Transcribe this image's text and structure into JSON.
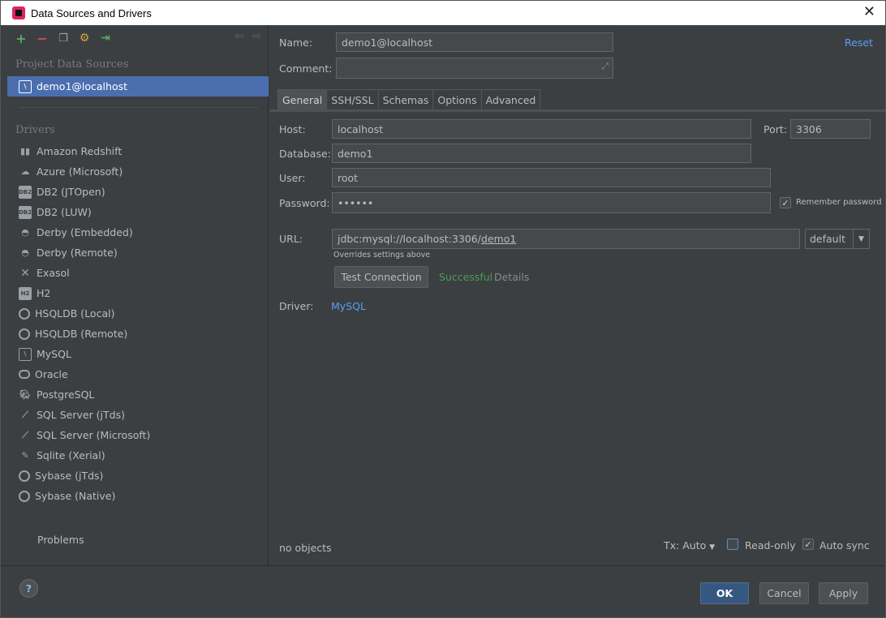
{
  "window": {
    "title": "Data Sources and Drivers",
    "close_glyph": "✕"
  },
  "left": {
    "nav_back": "⇦",
    "nav_forward": "⇨",
    "project_heading": "Project Data Sources",
    "selected_source": "demo1@localhost",
    "drivers_heading": "Drivers",
    "drivers": [
      {
        "label": "Amazon Redshift",
        "icon": "redshift-icon"
      },
      {
        "label": "Azure (Microsoft)",
        "icon": "azure-icon"
      },
      {
        "label": "DB2 (JTOpen)",
        "icon": "db2-icon"
      },
      {
        "label": "DB2 (LUW)",
        "icon": "db2-icon"
      },
      {
        "label": "Derby (Embedded)",
        "icon": "derby-icon"
      },
      {
        "label": "Derby (Remote)",
        "icon": "derby-icon"
      },
      {
        "label": "Exasol",
        "icon": "exasol-icon"
      },
      {
        "label": "H2",
        "icon": "h2-icon"
      },
      {
        "label": "HSQLDB (Local)",
        "icon": "hsqldb-icon"
      },
      {
        "label": "HSQLDB (Remote)",
        "icon": "hsqldb-icon"
      },
      {
        "label": "MySQL",
        "icon": "mysql-icon"
      },
      {
        "label": "Oracle",
        "icon": "oracle-icon"
      },
      {
        "label": "PostgreSQL",
        "icon": "postgresql-icon"
      },
      {
        "label": "SQL Server (jTds)",
        "icon": "sqlserver-icon"
      },
      {
        "label": "SQL Server (Microsoft)",
        "icon": "sqlserver-icon"
      },
      {
        "label": "Sqlite (Xerial)",
        "icon": "sqlite-icon"
      },
      {
        "label": "Sybase (jTds)",
        "icon": "sybase-icon"
      },
      {
        "label": "Sybase (Native)",
        "icon": "sybase-icon"
      }
    ],
    "problems_label": "Problems"
  },
  "form": {
    "name_label": "Name:",
    "name_value": "demo1@localhost",
    "comment_label": "Comment:",
    "comment_value": "",
    "reset_label": "Reset",
    "tabs": [
      "General",
      "SSH/SSL",
      "Schemas",
      "Options",
      "Advanced"
    ],
    "host_label": "Host:",
    "host_value": "localhost",
    "port_label": "Port:",
    "port_value": "3306",
    "database_label": "Database:",
    "database_value": "demo1",
    "user_label": "User:",
    "user_value": "root",
    "password_label": "Password:",
    "password_value": "••••••",
    "remember_password_label": "Remember password",
    "url_label": "URL:",
    "url_prefix": "jdbc:mysql://localhost:3306/",
    "url_db": "demo1",
    "url_mode": "default",
    "overrides_note": "Overrides settings above",
    "test_connection_label": "Test Connection",
    "test_status": "Successful",
    "details_label": "Details",
    "driver_label": "Driver:",
    "driver_value": "MySQL",
    "objects_status": "no objects",
    "tx_label": "Tx: Auto",
    "readonly_label": "Read-only",
    "autosync_label": "Auto sync"
  },
  "buttons": {
    "help": "?",
    "ok": "OK",
    "cancel": "Cancel",
    "apply": "Apply"
  },
  "colors": {
    "selection": "#4b6eaf",
    "success": "#499c54",
    "link": "#589df6",
    "primary_button": "#365880"
  }
}
